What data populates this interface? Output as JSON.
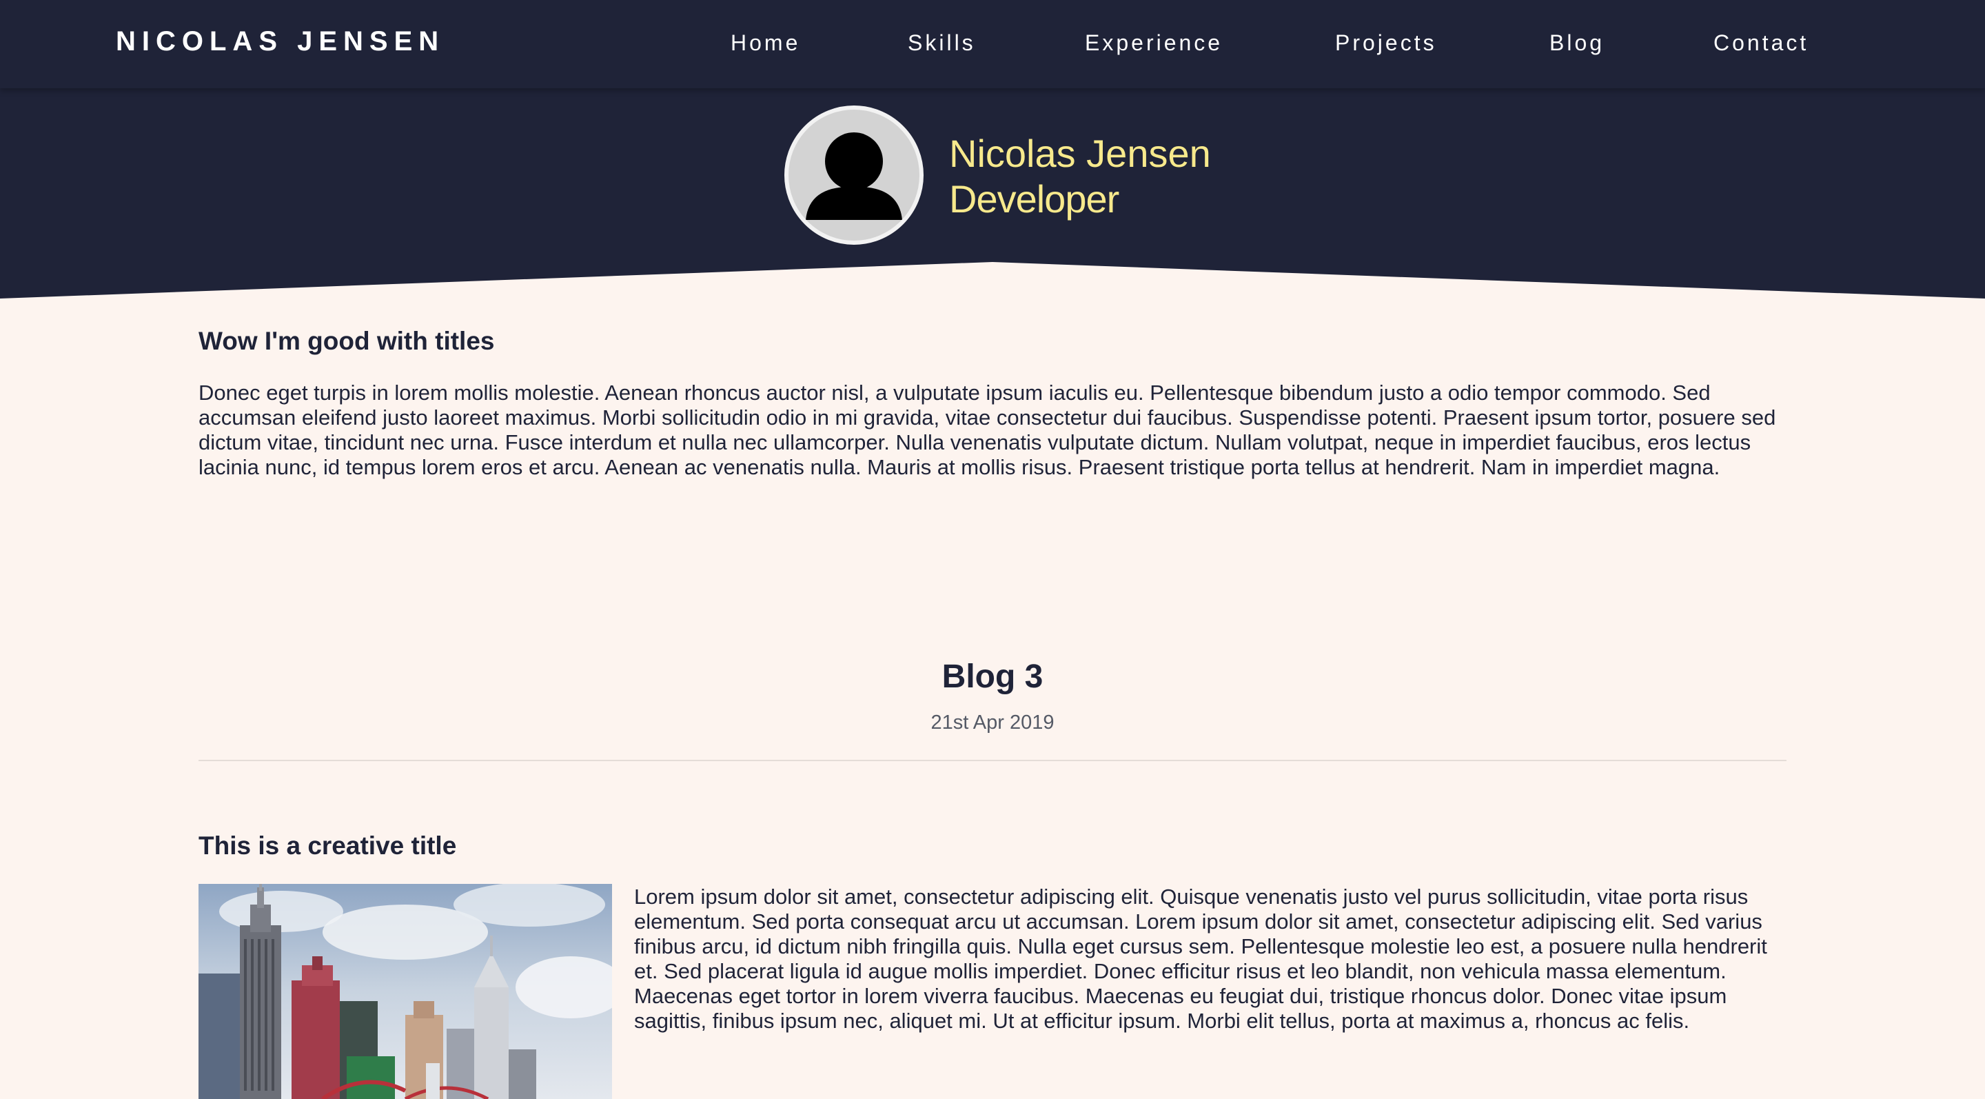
{
  "navbar": {
    "brand": "NICOLAS JENSEN",
    "links": [
      {
        "label": "Home"
      },
      {
        "label": "Skills"
      },
      {
        "label": "Experience"
      },
      {
        "label": "Projects"
      },
      {
        "label": "Blog"
      },
      {
        "label": "Contact"
      }
    ]
  },
  "hero": {
    "name": "Nicolas Jensen",
    "role": "Developer",
    "avatar_icon": "user-silhouette-icon"
  },
  "intro": {
    "title": "Wow I'm good with titles",
    "body": "Donec eget turpis in lorem mollis molestie. Aenean rhoncus auctor nisl, a vulputate ipsum iaculis eu. Pellentesque bibendum justo a odio tempor commodo. Sed accumsan eleifend justo laoreet maximus. Morbi sollicitudin odio in mi gravida, vitae consectetur dui faucibus. Suspendisse potenti. Praesent ipsum tortor, posuere sed dictum vitae, tincidunt nec urna. Fusce interdum et nulla nec ullamcorper. Nulla venenatis vulputate dictum. Nullam volutpat, neque in imperdiet faucibus, eros lectus lacinia nunc, id tempus lorem eros et arcu. Aenean ac venenatis nulla. Mauris at mollis risus. Praesent tristique porta tellus at hendrerit. Nam in imperdiet magna."
  },
  "blog": {
    "title": "Blog 3",
    "date": "21st Apr 2019"
  },
  "post": {
    "title": "This is a creative title",
    "body": "Lorem ipsum dolor sit amet, consectetur adipiscing elit. Quisque venenatis justo vel purus sollicitudin, vitae porta risus elementum. Sed porta consequat arcu ut accumsan. Lorem ipsum dolor sit amet, consectetur adipiscing elit. Sed varius finibus arcu, id dictum nibh fringilla quis. Nulla eget cursus sem. Pellentesque molestie leo est, a posuere nulla hendrerit et. Sed placerat ligula id augue mollis imperdiet. Donec efficitur risus et leo blandit, non vehicula massa elementum. Maecenas eget tortor in lorem viverra faucibus. Maecenas eu feugiat dui, tristique rhoncus dolor. Donec vitae ipsum sagittis, finibus ipsum nec, aliquet mi. Ut at efficitur ipsum. Morbi elit tellus, porta at maximus a, rhoncus ac felis.",
    "image_subject": "city-skyline-photo"
  },
  "colors": {
    "navy": "#1f2338",
    "cream": "#fdf4ef",
    "accent_yellow": "#f7e98c"
  }
}
